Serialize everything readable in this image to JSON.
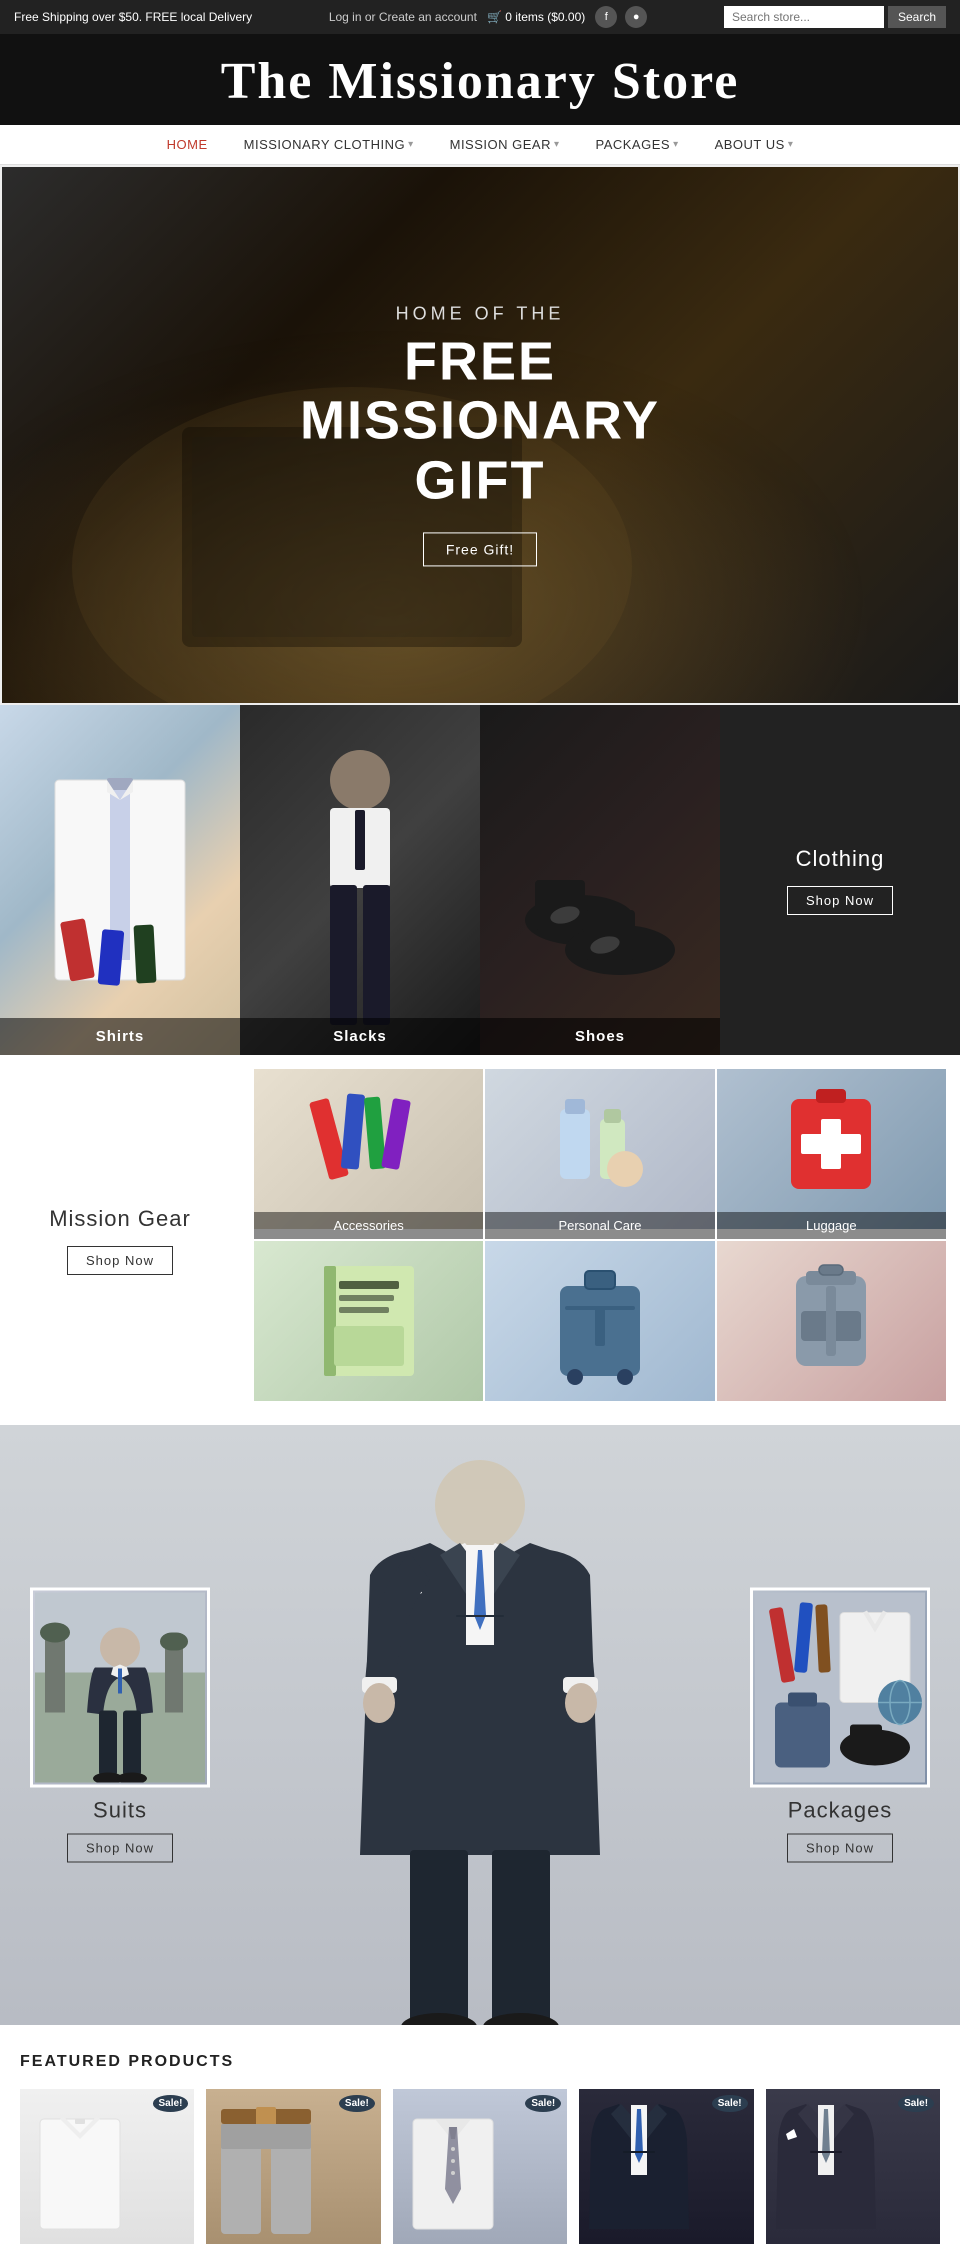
{
  "topbar": {
    "shipping_text": "Free Shipping over $50. FREE local Delivery",
    "account_text": "Log in or Create an account",
    "cart_text": "🛒 0 items ($0.00)",
    "search_placeholder": "Search store...",
    "search_button": "Search"
  },
  "header": {
    "site_title": "The Missionary Store"
  },
  "nav": {
    "items": [
      {
        "label": "HOME",
        "active": true,
        "has_dropdown": false
      },
      {
        "label": "MISSIONARY CLOTHING",
        "active": false,
        "has_dropdown": true
      },
      {
        "label": "MISSION GEAR",
        "active": false,
        "has_dropdown": true
      },
      {
        "label": "PACKAGES",
        "active": false,
        "has_dropdown": true
      },
      {
        "label": "ABOUT US",
        "active": false,
        "has_dropdown": true
      }
    ]
  },
  "hero": {
    "subtitle": "HOME OF THE",
    "title": "FREE MISSIONARY GIFT",
    "button_label": "Free Gift!"
  },
  "clothing": {
    "section_title": "Clothing",
    "shop_now": "Shop Now",
    "items": [
      {
        "label": "Shirts",
        "emoji": "👔"
      },
      {
        "label": "Slacks",
        "emoji": "👖"
      },
      {
        "label": "Shoes",
        "emoji": "👞"
      }
    ]
  },
  "mission_gear": {
    "section_title": "Mission Gear",
    "shop_now": "Shop Now",
    "items": [
      {
        "label": "Accessories",
        "bg": "accessories"
      },
      {
        "label": "Personal Care",
        "bg": "personalcare"
      },
      {
        "label": "Luggage",
        "bg": "luggage"
      },
      {
        "label": "",
        "bg": "book"
      },
      {
        "label": "",
        "bg": "luggage2"
      },
      {
        "label": "",
        "bg": "firstaid"
      }
    ]
  },
  "suits_section": {
    "suits_label": "Suits",
    "suits_shop_now": "Shop Now",
    "packages_label": "Packages",
    "packages_shop_now": "Shop Now"
  },
  "featured": {
    "title": "FEATURED PRODUCTS",
    "items": [
      {
        "label": "Shirt",
        "sale": "Sale!",
        "emoji": "👕"
      },
      {
        "label": "Pants",
        "sale": "Sale!",
        "emoji": "👖"
      },
      {
        "label": "Tie",
        "sale": "Sale!",
        "emoji": "👔"
      },
      {
        "label": "Suit Dark",
        "sale": "Sale!",
        "emoji": "🤵"
      },
      {
        "label": "Suit",
        "sale": "Sale!",
        "emoji": "🕴"
      }
    ]
  }
}
